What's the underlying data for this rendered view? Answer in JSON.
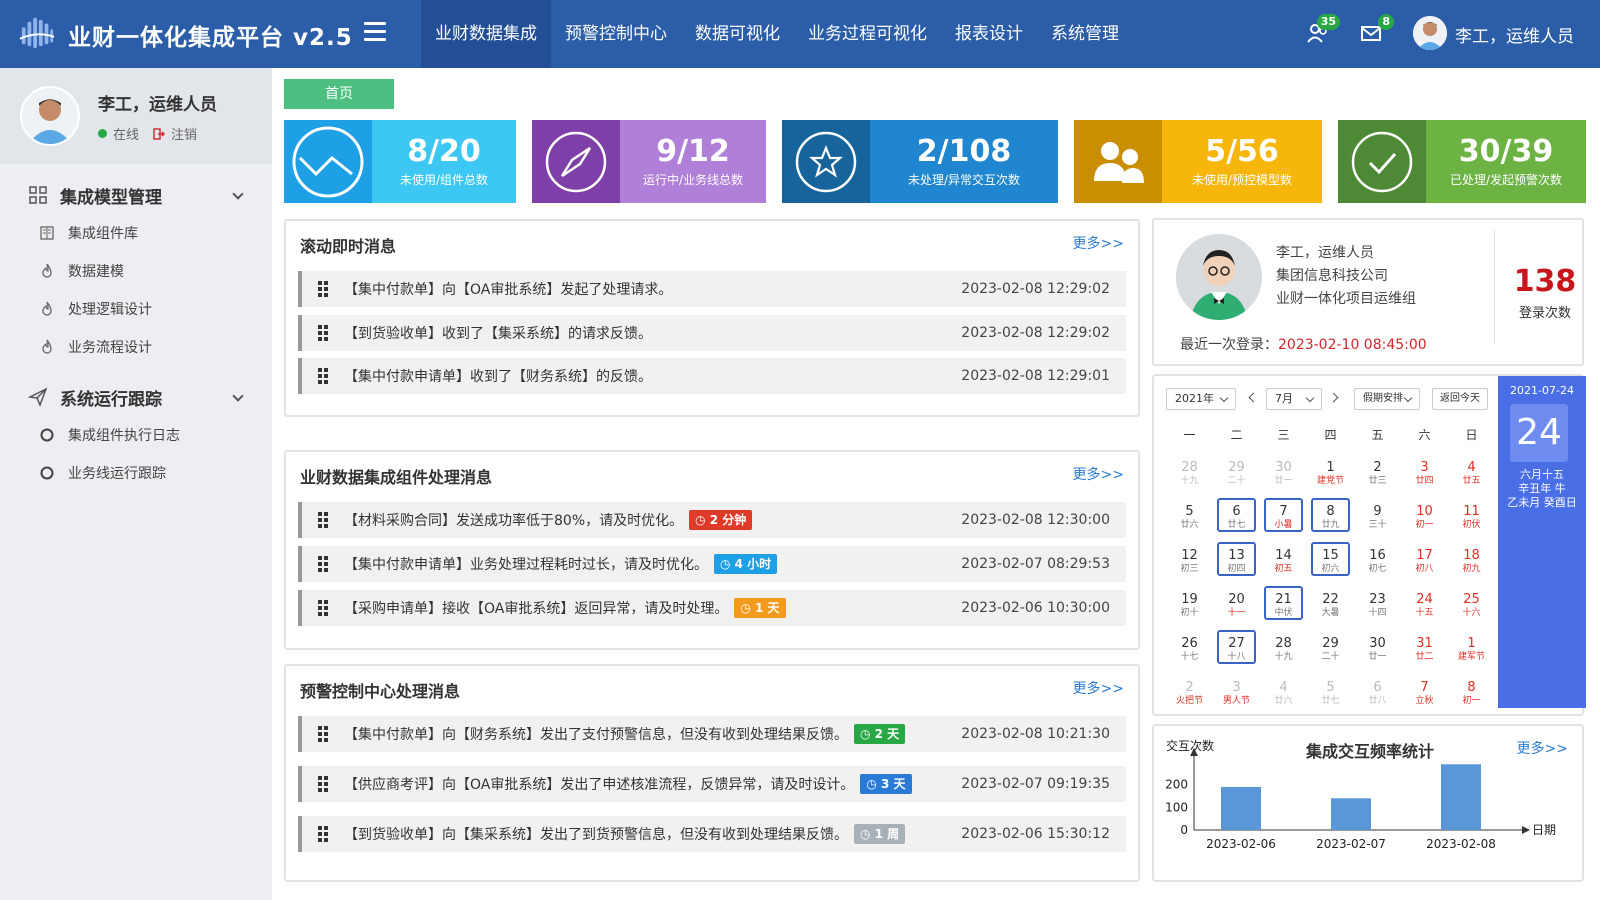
{
  "app": {
    "title": "业财一体化集成平台 v2.5",
    "nav": [
      "业财数据集成",
      "预警控制中心",
      "数据可视化",
      "业务过程可视化",
      "报表设计",
      "系统管理"
    ],
    "active_nav": 0,
    "people_badge": "35",
    "mail_badge": "8",
    "user": "李工，运维人员"
  },
  "sidebar": {
    "user_name": "李工，运维人员",
    "online": "在线",
    "logout": "注销",
    "groups": [
      {
        "label": "集成模型管理",
        "items": [
          "集成组件库",
          "数据建模",
          "处理逻辑设计",
          "业务流程设计"
        ]
      },
      {
        "label": "系统运行跟踪",
        "items": [
          "集成组件执行日志",
          "业务线运行跟踪"
        ]
      }
    ]
  },
  "home_tab": "首页",
  "stats": [
    {
      "value": "8/20",
      "label": "未使用/组件总数",
      "icon": "clock-icon",
      "color_icon": "#1ea0e6",
      "color_body": "#3dc8f4"
    },
    {
      "value": "9/12",
      "label": "运行中/业务线总数",
      "icon": "compass-icon",
      "color_icon": "#7e3fa8",
      "color_body": "#b07fd8"
    },
    {
      "value": "2/108",
      "label": "未处理/异常交互次数",
      "icon": "star-icon",
      "color_icon": "#17639c",
      "color_body": "#1f86cf"
    },
    {
      "value": "5/56",
      "label": "未使用/预控模型数",
      "icon": "users-icon",
      "color_icon": "#c98f00",
      "color_body": "#f6b60c"
    },
    {
      "value": "30/39",
      "label": "已处理/发起预警次数",
      "icon": "check-icon",
      "color_icon": "#4e8a36",
      "color_body": "#6cb344"
    }
  ],
  "panels": [
    {
      "title": "滚动即时消息",
      "more": "更多>>",
      "messages": [
        {
          "text": "【集中付款单】向【OA审批系统】发起了处理请求。",
          "time": "2023-02-08  12:29:02"
        },
        {
          "text": "【到货验收单】收到了【集采系统】的请求反馈。",
          "time": "2023-02-08  12:29:02"
        },
        {
          "text": "【集中付款申请单】收到了【财务系统】的反馈。",
          "time": "2023-02-08  12:29:01"
        }
      ]
    },
    {
      "title": "业财数据集成组件处理消息",
      "more": "更多>>",
      "messages": [
        {
          "text": "【材料采购合同】发送成功率低于80%，请及时优化。",
          "tag": "2 分钟",
          "tag_color": "#e03a2a",
          "time": "2023-02-08  12:30:00"
        },
        {
          "text": "【集中付款申请单】业务处理过程耗时过长，请及时优化。",
          "tag": "4 小时",
          "tag_color": "#1ea0e6",
          "time": "2023-02-07  08:29:53"
        },
        {
          "text": "【采购申请单】接收【OA审批系统】返回异常，请及时处理。",
          "tag": "1 天",
          "tag_color": "#f29b1c",
          "time": "2023-02-06  10:30:00"
        }
      ]
    },
    {
      "title": "预警控制中心处理消息",
      "more": "更多>>",
      "messages": [
        {
          "text": "【集中付款单】向【财务系统】发出了支付预警信息，但没有收到处理结果反馈。",
          "tag": "2 天",
          "tag_color": "#28a745",
          "time": "2023-02-08  10:21:30"
        },
        {
          "text": "【供应商考评】向【OA审批系统】发出了申述核准流程，反馈异常，请及时设计。",
          "tag": "3 天",
          "tag_color": "#2b7bd6",
          "time": "2023-02-07  09:19:35"
        },
        {
          "text": "【到货验收单】向【集采系统】发出了到货预警信息，但没有收到处理结果反馈。",
          "tag": "1 周",
          "tag_color": "#a9b1b8",
          "time": "2023-02-06  15:30:12"
        }
      ]
    }
  ],
  "profile": {
    "name": "李工，运维人员",
    "company": "集团信息科技公司",
    "team": "业财一体化项目运维组",
    "last_login_label": "最近一次登录：",
    "last_login": "2023-02-10 08:45:00",
    "login_count": "138",
    "login_count_label": "登录次数"
  },
  "calendar": {
    "year": "2021年",
    "month": "7月",
    "holiday": "假期安排",
    "today_btn": "返回今天",
    "weekdays": [
      "一",
      "二",
      "三",
      "四",
      "五",
      "六",
      "日"
    ],
    "days": [
      [
        "28",
        "十九"
      ],
      [
        "29",
        "二十"
      ],
      [
        "30",
        "廿一"
      ],
      [
        "1",
        "建党节"
      ],
      [
        "2",
        "廿三"
      ],
      [
        "3",
        "廿四"
      ],
      [
        "4",
        "廿五"
      ],
      [
        "5",
        "廿六"
      ],
      [
        "6",
        "廿七"
      ],
      [
        "7",
        "小暑"
      ],
      [
        "8",
        "廿九"
      ],
      [
        "9",
        "三十"
      ],
      [
        "10",
        "初一"
      ],
      [
        "11",
        "初伏"
      ],
      [
        "12",
        "初三"
      ],
      [
        "13",
        "初四"
      ],
      [
        "14",
        "初五"
      ],
      [
        "15",
        "初六"
      ],
      [
        "16",
        "初七"
      ],
      [
        "17",
        "初八"
      ],
      [
        "18",
        "初九"
      ],
      [
        "19",
        "初十"
      ],
      [
        "20",
        "十一"
      ],
      [
        "21",
        "中伏"
      ],
      [
        "22",
        "大暑"
      ],
      [
        "23",
        "十四"
      ],
      [
        "24",
        "十五"
      ],
      [
        "25",
        "十六"
      ],
      [
        "26",
        "十七"
      ],
      [
        "27",
        "十八"
      ],
      [
        "28",
        "十九"
      ],
      [
        "29",
        "二十"
      ],
      [
        "30",
        "廿一"
      ],
      [
        "31",
        "廿二"
      ],
      [
        "1",
        "建军节"
      ],
      [
        "2",
        "火把节"
      ],
      [
        "3",
        "男人节"
      ],
      [
        "4",
        "廿六"
      ],
      [
        "5",
        "廿七"
      ],
      [
        "6",
        "廿八"
      ],
      [
        "7",
        "立秋"
      ],
      [
        "8",
        "初一"
      ]
    ],
    "side_date": "2021-07-24",
    "side_day": "24",
    "side_lunar": [
      "六月十五",
      "辛丑年 牛",
      "乙未月 癸酉日"
    ]
  },
  "chart_panel": {
    "title": "集成交互频率统计",
    "more": "更多>>"
  },
  "chart_data": {
    "type": "bar",
    "title": "集成交互频率统计",
    "ylabel": "交互次数",
    "xlabel": "日期",
    "categories": [
      "2023-02-06",
      "2023-02-07",
      "2023-02-08"
    ],
    "values": [
      190,
      140,
      290
    ],
    "yticks": [
      0,
      100,
      200
    ],
    "ylim": [
      0,
      300
    ],
    "color": "#5b97d8"
  }
}
